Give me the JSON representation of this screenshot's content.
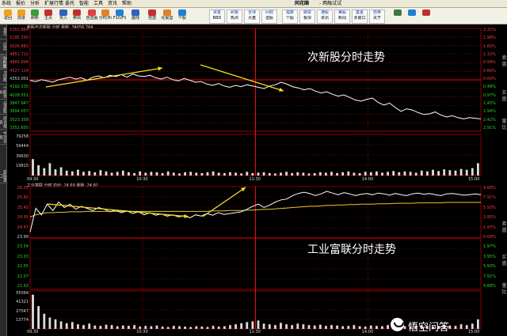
{
  "menu": [
    "系统",
    "报价",
    "分析",
    "扩展行情",
    "委托",
    "智能",
    "工具",
    "资讯",
    "帮助"
  ],
  "brand": "同花顺",
  "brand_sub": "- 两融试试",
  "toolbar_left": [
    {
      "label": "返回",
      "color": "#f0a020"
    },
    {
      "label": "前进",
      "color": "#f0a020"
    },
    {
      "label": "刷新",
      "color": "#3a9a3a"
    },
    {
      "label": "主页",
      "color": "#c03030"
    },
    {
      "label": "买入",
      "color": "#3060c0"
    },
    {
      "label": "卖出",
      "color": "#c03030"
    },
    {
      "label": "自选股",
      "color": "#e04040"
    },
    {
      "label": "分时/K线",
      "color": "#e08020"
    },
    {
      "label": "F10/F9",
      "color": "#2080d0"
    },
    {
      "label": "画线",
      "color": "#3060c0"
    },
    {
      "label": "自选",
      "color": "#c03030"
    },
    {
      "label": "论股堂",
      "color": "#e08020"
    },
    {
      "label": "个股",
      "color": "#2080d0"
    }
  ],
  "toolbar_right": [
    {
      "top": "资金",
      "bottom": "BBD"
    },
    {
      "top": "研报",
      "bottom": "热点"
    },
    {
      "top": "全球",
      "bottom": "大盘"
    },
    {
      "top": "问财",
      "bottom": "选股"
    },
    {
      "top": "指数",
      "bottom": "个股"
    },
    {
      "top": "期货",
      "bottom": "板块"
    },
    {
      "top": "港股",
      "bottom": "资讯"
    },
    {
      "top": "美股",
      "bottom": "新闻"
    },
    {
      "top": "基金",
      "bottom": "多窗口"
    },
    {
      "top": "债券",
      "bottom": "关于"
    }
  ],
  "side_tabs": [
    "首页",
    "应用",
    "分时图",
    "K线图",
    "个股资料",
    "自选股",
    "综合排名",
    "牛叉诊股"
  ],
  "side_tabs_bottom": [
    "超级盘口"
  ],
  "right_labels": [
    "卖",
    "盘",
    "买",
    "盘",
    "量",
    "比",
    "卖",
    "盘",
    "买",
    "盘",
    "量",
    "比"
  ],
  "top_chart": {
    "header": "新股与次新股  分时  最新: 34056.764",
    "left_labels": [
      {
        "text": "5353.884",
        "c": "r"
      },
      {
        "text": "5195.330",
        "c": "r"
      },
      {
        "text": "5026.882",
        "c": "r"
      },
      {
        "text": "4851.712",
        "c": "r"
      },
      {
        "text": "4681.604",
        "c": "r"
      },
      {
        "text": "4527.124",
        "c": "r"
      },
      {
        "text": "4353.001",
        "c": "w"
      },
      {
        "text": "4192.535",
        "c": "g"
      },
      {
        "text": "4028.551",
        "c": "g"
      },
      {
        "text": "3847.947",
        "c": "g"
      },
      {
        "text": "3694.057",
        "c": "g"
      },
      {
        "text": "3523.358",
        "c": "g"
      },
      {
        "text": "3352.650",
        "c": "g"
      }
    ],
    "right_labels": [
      {
        "text": "2.31%",
        "c": "r"
      },
      {
        "text": "1.98%",
        "c": "r"
      },
      {
        "text": "1.65%",
        "c": "r"
      },
      {
        "text": "1.32%",
        "c": "r"
      },
      {
        "text": "0.99%",
        "c": "r"
      },
      {
        "text": "0.66%",
        "c": "r"
      },
      {
        "text": "0.00%",
        "c": "r"
      },
      {
        "text": "0.48%",
        "c": "g"
      },
      {
        "text": "0.97%",
        "c": "g"
      },
      {
        "text": "1.45%",
        "c": "g"
      },
      {
        "text": "1.94%",
        "c": "g"
      },
      {
        "text": "2.42%",
        "c": "g"
      },
      {
        "text": "2.91%",
        "c": "g"
      }
    ],
    "volume_labels": [
      "79258",
      "59444",
      "39630",
      "19815"
    ],
    "annotation": "次新股分时走势",
    "price_line": [
      0.27,
      0.29,
      0.26,
      0.28,
      0.3,
      0.26,
      0.24,
      0.22,
      0.25,
      0.23,
      0.27,
      0.22,
      0.2,
      0.23,
      0.19,
      0.21,
      0.18,
      0.22,
      0.17,
      0.2,
      0.21,
      0.19,
      0.23,
      0.25,
      0.22,
      0.26,
      0.28,
      0.24,
      0.27,
      0.3,
      0.29,
      0.33,
      0.35,
      0.32,
      0.36,
      0.38,
      0.35,
      0.37,
      0.34,
      0.36,
      0.38,
      0.4,
      0.36,
      0.34,
      0.3,
      0.33,
      0.37,
      0.39,
      0.42,
      0.4,
      0.44,
      0.47,
      0.45,
      0.49,
      0.52,
      0.5,
      0.54,
      0.58,
      0.6,
      0.57,
      0.55,
      0.62,
      0.66,
      0.63,
      0.7,
      0.76,
      0.72,
      0.74,
      0.78,
      0.81,
      0.8,
      0.77,
      0.82,
      0.85,
      0.83,
      0.86,
      0.88,
      0.86,
      0.87,
      0.88
    ],
    "volume_bars": [
      0.4,
      0.25,
      0.18,
      0.3,
      0.15,
      0.2,
      0.12,
      0.1,
      0.14,
      0.09,
      0.11,
      0.08,
      0.13,
      0.1,
      0.07,
      0.09,
      0.12,
      0.08,
      0.06,
      0.1,
      0.07,
      0.09,
      0.08,
      0.06,
      0.1,
      0.07,
      0.05,
      0.08,
      0.09,
      0.07,
      0.06,
      0.08,
      0.1,
      0.07,
      0.06,
      0.08,
      0.07,
      0.05,
      0.09,
      0.06,
      0.07,
      0.08,
      0.06,
      0.05,
      0.07,
      0.09,
      0.06,
      0.08,
      0.07,
      0.05,
      0.06,
      0.08,
      0.07,
      0.09,
      0.06,
      0.08,
      0.1,
      0.07,
      0.06,
      0.09,
      0.08,
      0.1,
      0.07,
      0.09,
      0.11,
      0.08,
      0.1,
      0.09,
      0.07,
      0.12,
      0.1,
      0.14,
      0.11,
      0.15,
      0.13,
      0.12,
      0.16,
      0.14,
      0.18,
      0.3
    ]
  },
  "bottom_chart": {
    "header": "工业富联  分时  均价: 24.69  最新: 24.82",
    "left_labels": [
      {
        "text": "26.35",
        "c": "r"
      },
      {
        "text": "25.82",
        "c": "r"
      },
      {
        "text": "25.43",
        "c": "r"
      },
      {
        "text": "24.95",
        "c": "r"
      },
      {
        "text": "24.47",
        "c": "r"
      },
      {
        "text": "23.99",
        "c": "w"
      },
      {
        "text": "23.54",
        "c": "g"
      },
      {
        "text": "23.03",
        "c": "g"
      },
      {
        "text": "22.55",
        "c": "g"
      },
      {
        "text": "22.07",
        "c": "g"
      },
      {
        "text": "21.62",
        "c": "g"
      }
    ],
    "right_labels": [
      {
        "text": "9.88%",
        "c": "r"
      },
      {
        "text": "7.91%",
        "c": "r"
      },
      {
        "text": "5.93%",
        "c": "r"
      },
      {
        "text": "3.95%",
        "c": "r"
      },
      {
        "text": "1.97%",
        "c": "r"
      },
      {
        "text": "0.00%",
        "c": "r"
      },
      {
        "text": "1.97%",
        "c": "g"
      },
      {
        "text": "3.95%",
        "c": "g"
      },
      {
        "text": "5.93%",
        "c": "g"
      },
      {
        "text": "7.91%",
        "c": "g"
      },
      {
        "text": "9.88%",
        "c": "g"
      }
    ],
    "volume_labels": [
      "55094",
      "41321",
      "27547",
      "13774"
    ],
    "annotation": "工业富联分时走势",
    "price_line": [
      0.95,
      0.4,
      0.55,
      0.3,
      0.45,
      0.25,
      0.38,
      0.3,
      0.42,
      0.35,
      0.4,
      0.45,
      0.38,
      0.42,
      0.48,
      0.44,
      0.5,
      0.46,
      0.52,
      0.48,
      0.55,
      0.5,
      0.56,
      0.53,
      0.58,
      0.55,
      0.6,
      0.57,
      0.62,
      0.55,
      0.58,
      0.52,
      0.56,
      0.5,
      0.54,
      0.52,
      0.5,
      0.48,
      0.42,
      0.35,
      0.3,
      0.38,
      0.32,
      0.25,
      0.2,
      0.18,
      0.1,
      0.05,
      0.02,
      0.05,
      0.1,
      0.06,
      0.0,
      0.04,
      0.08,
      0.03,
      0.06,
      0.1,
      0.07,
      0.05,
      0.08,
      0.04,
      0.06,
      0.09,
      0.05,
      0.08,
      0.1,
      0.06,
      0.04,
      0.07,
      0.05,
      0.08,
      0.1,
      0.06,
      0.05,
      0.07,
      0.09,
      0.08,
      0.06,
      0.08
    ],
    "avg_line": [
      0.6,
      0.55,
      0.52,
      0.5,
      0.5,
      0.49,
      0.49,
      0.48,
      0.48,
      0.48,
      0.47,
      0.47,
      0.47,
      0.47,
      0.47,
      0.47,
      0.47,
      0.47,
      0.47,
      0.47,
      0.47,
      0.47,
      0.47,
      0.47,
      0.47,
      0.47,
      0.47,
      0.47,
      0.47,
      0.47,
      0.47,
      0.47,
      0.46,
      0.46,
      0.46,
      0.45,
      0.45,
      0.45,
      0.44,
      0.44,
      0.43,
      0.42,
      0.42,
      0.41,
      0.4,
      0.39,
      0.38,
      0.37,
      0.36,
      0.35,
      0.35,
      0.34,
      0.33,
      0.33,
      0.32,
      0.32,
      0.31,
      0.31,
      0.3,
      0.3,
      0.3,
      0.29,
      0.29,
      0.29,
      0.28,
      0.28,
      0.28,
      0.28,
      0.27,
      0.27,
      0.27,
      0.27,
      0.27,
      0.26,
      0.26,
      0.26,
      0.26,
      0.26,
      0.26,
      0.26
    ],
    "volume_bars": [
      0.9,
      0.6,
      0.4,
      0.3,
      0.25,
      0.2,
      0.15,
      0.18,
      0.12,
      0.1,
      0.14,
      0.09,
      0.08,
      0.11,
      0.1,
      0.07,
      0.09,
      0.08,
      0.1,
      0.06,
      0.08,
      0.07,
      0.09,
      0.06,
      0.05,
      0.08,
      0.07,
      0.06,
      0.05,
      0.07,
      0.06,
      0.05,
      0.08,
      0.06,
      0.07,
      0.1,
      0.12,
      0.15,
      0.18,
      0.2,
      0.22,
      0.14,
      0.12,
      0.1,
      0.16,
      0.12,
      0.1,
      0.14,
      0.12,
      0.1,
      0.09,
      0.11,
      0.08,
      0.1,
      0.09,
      0.07,
      0.08,
      0.1,
      0.07,
      0.06,
      0.09,
      0.08,
      0.07,
      0.1,
      0.08,
      0.09,
      0.07,
      0.06,
      0.08,
      0.09,
      0.07,
      0.06,
      0.08,
      0.1,
      0.09,
      0.08,
      0.12,
      0.1,
      0.14,
      0.25
    ]
  },
  "time_labels": [
    "09:30",
    "10:30",
    "11:30",
    "14:00",
    "15:00"
  ],
  "watermark": "悟空问答",
  "colors": {
    "up": "#ff3b3b",
    "down": "#22dd22",
    "grid": "#8b0000",
    "line": "#ffffff",
    "avg": "#e8c830",
    "arrow": "#f0e020"
  }
}
